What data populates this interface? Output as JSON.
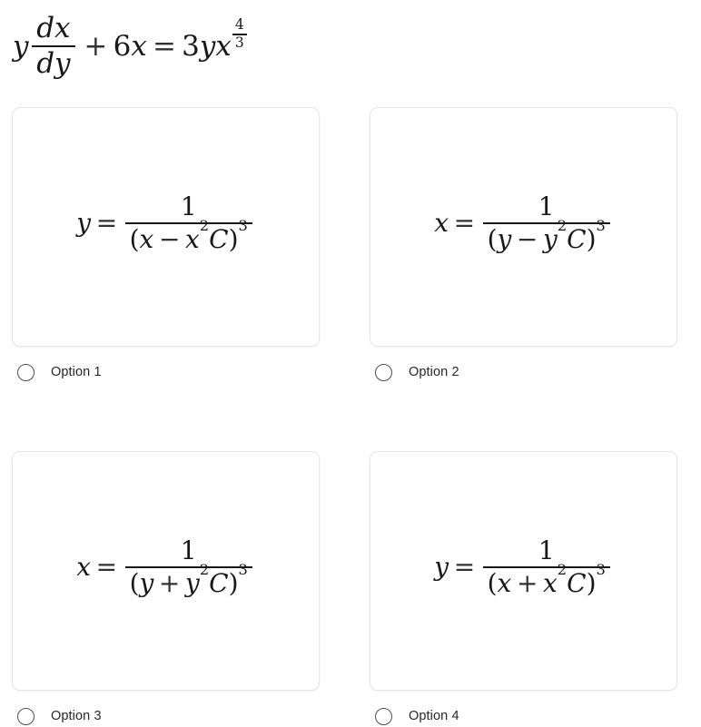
{
  "question": {
    "equation_text": "y dx/dy + 6x = 3y x^(4/3)",
    "lhs_var": "y",
    "fraction": {
      "numerator": "dx",
      "denominator": "dy"
    },
    "plus_op": "+",
    "term_coefficient": "6",
    "term_var": "x",
    "equals_op": "=",
    "rhs_coefficient": "3",
    "rhs_var1": "y",
    "rhs_var2": "x",
    "rhs_exponent": {
      "numerator": "4",
      "denominator": "3"
    }
  },
  "options": [
    {
      "id": "option-1",
      "label": "Option 1",
      "equation_text": "y = 1/(x - x^2 C)^3",
      "lhs": "y",
      "equals": "=",
      "numerator": "1",
      "denominator": {
        "open_paren": "(",
        "var1": "x",
        "operator": "−",
        "var2": "x",
        "var2_exponent": "2",
        "constant": "C",
        "close_paren": ")",
        "power": "3"
      },
      "selected": false
    },
    {
      "id": "option-2",
      "label": "Option 2",
      "equation_text": "x = 1/(y - y^2 C)^3",
      "lhs": "x",
      "equals": "=",
      "numerator": "1",
      "denominator": {
        "open_paren": "(",
        "var1": "y",
        "operator": "−",
        "var2": "y",
        "var2_exponent": "2",
        "constant": "C",
        "close_paren": ")",
        "power": "3"
      },
      "selected": false
    },
    {
      "id": "option-3",
      "label": "Option 3",
      "equation_text": "x = 1/(y + y^2 C)^3",
      "lhs": "x",
      "equals": "=",
      "numerator": "1",
      "denominator": {
        "open_paren": "(",
        "var1": "y",
        "operator": "+",
        "var2": "y",
        "var2_exponent": "2",
        "constant": "C",
        "close_paren": ")",
        "power": "3"
      },
      "selected": false
    },
    {
      "id": "option-4",
      "label": "Option 4",
      "equation_text": "y = 1/(x + x^2 C)^3",
      "lhs": "y",
      "equals": "=",
      "numerator": "1",
      "denominator": {
        "open_paren": "(",
        "var1": "x",
        "operator": "+",
        "var2": "x",
        "var2_exponent": "2",
        "constant": "C",
        "close_paren": ")",
        "power": "3"
      },
      "selected": false
    }
  ],
  "colors": {
    "page_background": "#ffffff",
    "card_background": "#ffffff",
    "card_border": "#e6e6e6",
    "math_text": "#16181c",
    "label_text": "#24272d",
    "radio_border": "#4a4d52"
  }
}
